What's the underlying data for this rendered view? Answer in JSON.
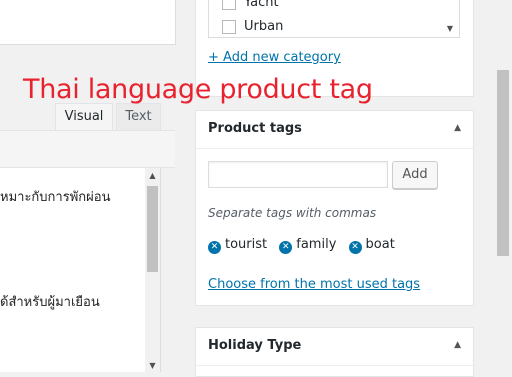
{
  "editor": {
    "tabs": {
      "visual": "Visual",
      "text": "Text"
    },
    "lines": [
      "หมาะกับการพักผ่อน",
      "ด้สำหรับผู้มาเยือน"
    ]
  },
  "annotation": "Thai language product tag",
  "categories": {
    "items": [
      {
        "label": "Yacht",
        "checked": false
      },
      {
        "label": "Urban",
        "checked": false
      }
    ],
    "add_link": "+ Add new category"
  },
  "product_tags": {
    "title": "Product tags",
    "input_value": "",
    "add_label": "Add",
    "hint": "Separate tags with commas",
    "tags": [
      "tourist",
      "family",
      "boat"
    ],
    "choose_link": "Choose from the most used tags"
  },
  "holiday_type": {
    "title": "Holiday Type"
  },
  "colors": {
    "link": "#0073aa",
    "annotation": "#e8232f"
  }
}
